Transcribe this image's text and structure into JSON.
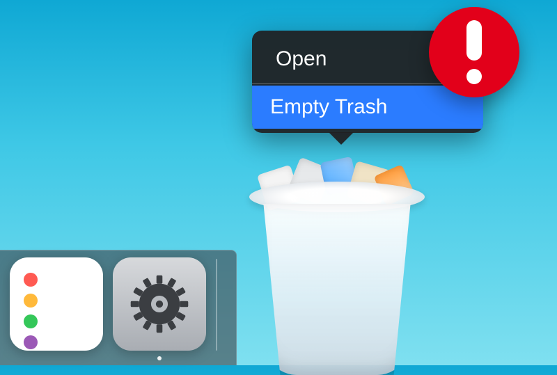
{
  "dock": {
    "apps": [
      {
        "id": "reminders",
        "name": "Reminders"
      },
      {
        "id": "settings",
        "name": "Settings"
      }
    ],
    "trash_name": "Trash"
  },
  "context_menu": {
    "open_label": "Open",
    "empty_trash_label": "Empty Trash"
  },
  "alert": {
    "symbol": "!"
  },
  "colors": {
    "accent": "#2b7cff",
    "alert": "#e2001a"
  }
}
